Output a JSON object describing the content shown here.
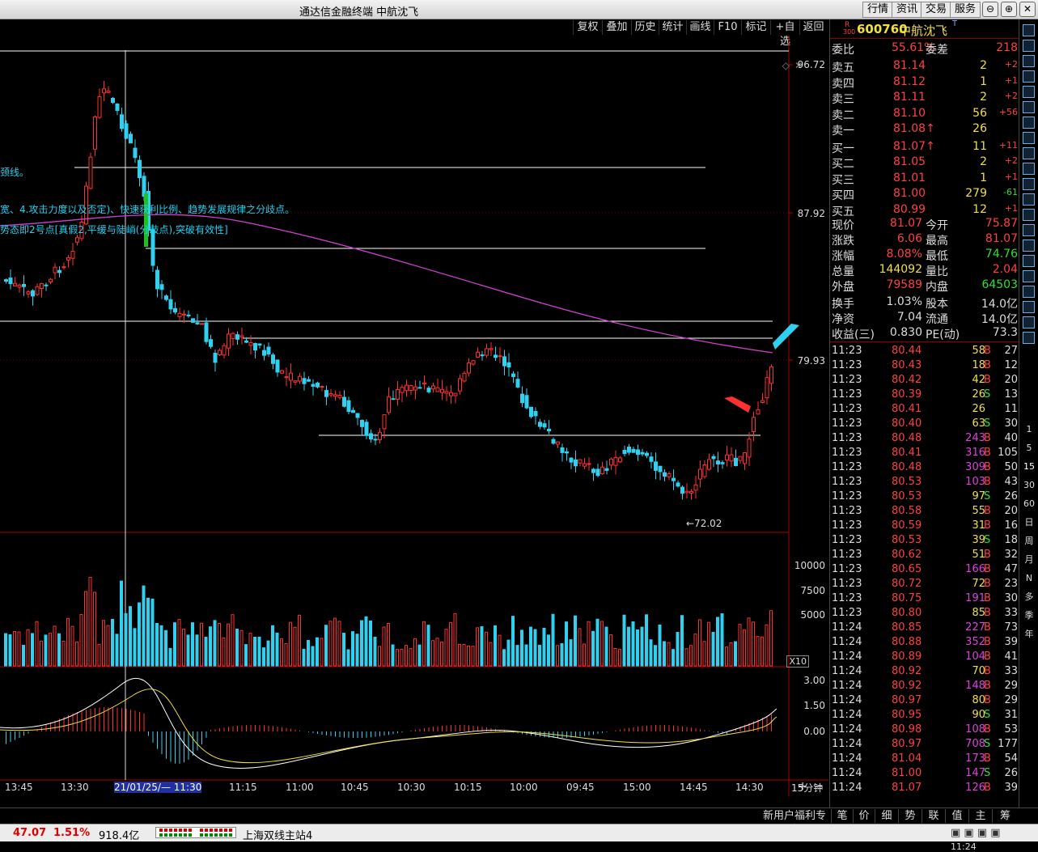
{
  "window": {
    "title": "通达信金融终端  中航沈飞"
  },
  "top_menu": [
    "行情",
    "资讯",
    "交易",
    "服务"
  ],
  "toolbar": [
    "复权",
    "叠加",
    "历史",
    "统计",
    "画线",
    "F10",
    "标记",
    "+自选",
    "返回"
  ],
  "price_axis": [
    "96.72",
    "87.92",
    "79.93"
  ],
  "volume_axis": [
    "10000",
    "7500",
    "5000"
  ],
  "volume_unit": "X10",
  "macd_axis": [
    "3.00",
    "1.50",
    "0.00"
  ],
  "low_marker": "←72.02",
  "annotations": [
    {
      "text": "颈线。",
      "color": "#20d0f0"
    },
    {
      "text": "宽、4.攻击力度以及否定)、快速获利比例、趋势发展规律之分歧点。",
      "color": "#20d0f0"
    },
    {
      "text": "势态即2号点[真假2,平缓与陡峭(分歧点),突破有效性]",
      "color": "#20d0f0"
    }
  ],
  "time_axis": {
    "ticks": [
      "13:45",
      "13:30",
      "21/01/25/— 11:30",
      "11:15",
      "11:00",
      "10:45",
      "10:30",
      "10:15",
      "10:00",
      "09:45",
      "15:00",
      "14:45",
      "14:30"
    ],
    "period": "15分钟"
  },
  "chart_data": {
    "type": "candlestick",
    "period": "15分钟",
    "ylim": [
      72.02,
      96.72
    ],
    "price_labels": [
      96.72,
      87.92,
      79.93
    ],
    "low": 72.02,
    "volume_ylim": [
      0,
      10000
    ],
    "macd_ylim": [
      -1.5,
      3.0
    ]
  },
  "bottom_tabs": [
    "新用户福利专享",
    "笔",
    "价",
    "细",
    "势",
    "联",
    "值",
    "主",
    "筹"
  ],
  "status": {
    "index_value": "47.07",
    "index_pct": "1.51%",
    "amount": "918.4亿",
    "server": "上海双线主站4",
    "time": "11:24"
  },
  "quote": {
    "code": "600760",
    "name": "中航沈飞",
    "tag": "T",
    "weibi_label": "委比",
    "weibi": "55.61%",
    "weicha_label": "委差",
    "weicha": "218",
    "asks": [
      {
        "label": "卖五",
        "price": "81.14",
        "vol": "2",
        "chg": "+2"
      },
      {
        "label": "卖四",
        "price": "81.12",
        "vol": "1",
        "chg": "+1"
      },
      {
        "label": "卖三",
        "price": "81.11",
        "vol": "2",
        "chg": "+2"
      },
      {
        "label": "卖二",
        "price": "81.10",
        "vol": "56",
        "chg": "+56"
      },
      {
        "label": "卖一",
        "price": "81.08↑",
        "vol": "26",
        "chg": ""
      }
    ],
    "bids": [
      {
        "label": "买一",
        "price": "81.07↑",
        "vol": "11",
        "chg": "+11"
      },
      {
        "label": "买二",
        "price": "81.05",
        "vol": "2",
        "chg": "+2"
      },
      {
        "label": "买三",
        "price": "81.01",
        "vol": "1",
        "chg": "+1"
      },
      {
        "label": "买四",
        "price": "81.00",
        "vol": "279",
        "chg": "-61"
      },
      {
        "label": "买五",
        "price": "80.99",
        "vol": "12",
        "chg": "+1"
      }
    ],
    "stats": [
      {
        "l1": "现价",
        "v1": "81.07",
        "c1": "#ff4040",
        "l2": "今开",
        "v2": "75.87",
        "c2": "#ff4040"
      },
      {
        "l1": "涨跌",
        "v1": "6.06",
        "c1": "#ff4040",
        "l2": "最高",
        "v2": "81.07",
        "c2": "#ff4040"
      },
      {
        "l1": "涨幅",
        "v1": "8.08%",
        "c1": "#ff4040",
        "l2": "最低",
        "v2": "74.76",
        "c2": "#30e030"
      },
      {
        "l1": "总量",
        "v1": "144092",
        "c1": "#f0e040",
        "l2": "量比",
        "v2": "2.04",
        "c2": "#ff4040"
      },
      {
        "l1": "外盘",
        "v1": "79589",
        "c1": "#ff4040",
        "l2": "内盘",
        "v2": "64503",
        "c2": "#30e030"
      }
    ],
    "stats2": [
      {
        "l1": "换手",
        "v1": "1.03%",
        "l2": "股本",
        "v2": "14.0亿"
      },
      {
        "l1": "净资",
        "v1": "7.04",
        "l2": "流通",
        "v2": "14.0亿"
      },
      {
        "l1": "收益(三)",
        "v1": "0.830",
        "l2": "PE(动)",
        "v2": "73.3"
      }
    ],
    "trades": [
      [
        "11:23",
        "80.44",
        "58",
        "B",
        "27"
      ],
      [
        "11:23",
        "80.43",
        "18",
        "B",
        "12"
      ],
      [
        "11:23",
        "80.42",
        "42",
        "B",
        "20"
      ],
      [
        "11:23",
        "80.39",
        "26",
        "S",
        "13"
      ],
      [
        "11:23",
        "80.41",
        "26",
        "",
        "11"
      ],
      [
        "11:23",
        "80.40",
        "63",
        "S",
        "30"
      ],
      [
        "11:23",
        "80.48",
        "243",
        "B",
        "40"
      ],
      [
        "11:23",
        "80.41",
        "316",
        "B",
        "105"
      ],
      [
        "11:23",
        "80.48",
        "309",
        "B",
        "50"
      ],
      [
        "11:23",
        "80.53",
        "103",
        "B",
        "43"
      ],
      [
        "11:23",
        "80.53",
        "97",
        "S",
        "26"
      ],
      [
        "11:23",
        "80.58",
        "55",
        "B",
        "20"
      ],
      [
        "11:23",
        "80.59",
        "31",
        "B",
        "16"
      ],
      [
        "11:23",
        "80.53",
        "39",
        "S",
        "18"
      ],
      [
        "11:23",
        "80.62",
        "51",
        "B",
        "32"
      ],
      [
        "11:23",
        "80.65",
        "166",
        "B",
        "47"
      ],
      [
        "11:23",
        "80.72",
        "72",
        "B",
        "23"
      ],
      [
        "11:23",
        "80.75",
        "191",
        "B",
        "30"
      ],
      [
        "11:23",
        "80.80",
        "85",
        "B",
        "33"
      ],
      [
        "11:24",
        "80.85",
        "227",
        "B",
        "73"
      ],
      [
        "11:24",
        "80.88",
        "352",
        "B",
        "39"
      ],
      [
        "11:24",
        "80.89",
        "104",
        "B",
        "41"
      ],
      [
        "11:24",
        "80.92",
        "70",
        "B",
        "33"
      ],
      [
        "11:24",
        "80.92",
        "148",
        "B",
        "29"
      ],
      [
        "11:24",
        "80.97",
        "80",
        "B",
        "29"
      ],
      [
        "11:24",
        "80.95",
        "90",
        "S",
        "31"
      ],
      [
        "11:24",
        "80.98",
        "108",
        "B",
        "53"
      ],
      [
        "11:24",
        "80.97",
        "708",
        "S",
        "177"
      ],
      [
        "11:24",
        "81.04",
        "173",
        "B",
        "54"
      ],
      [
        "11:24",
        "81.00",
        "147",
        "S",
        "26"
      ],
      [
        "11:24",
        "81.07",
        "126",
        "B",
        "39"
      ]
    ]
  },
  "sidebar": [
    "1",
    "5",
    "15",
    "30",
    "60",
    "日",
    "周",
    "月",
    "N",
    "多",
    "季",
    "年"
  ],
  "colors": {
    "up": "#ff3030",
    "down": "#30d0f0",
    "ma": "#d040d0",
    "macd_dif": "#ffffff",
    "macd_dea": "#f0e040"
  }
}
